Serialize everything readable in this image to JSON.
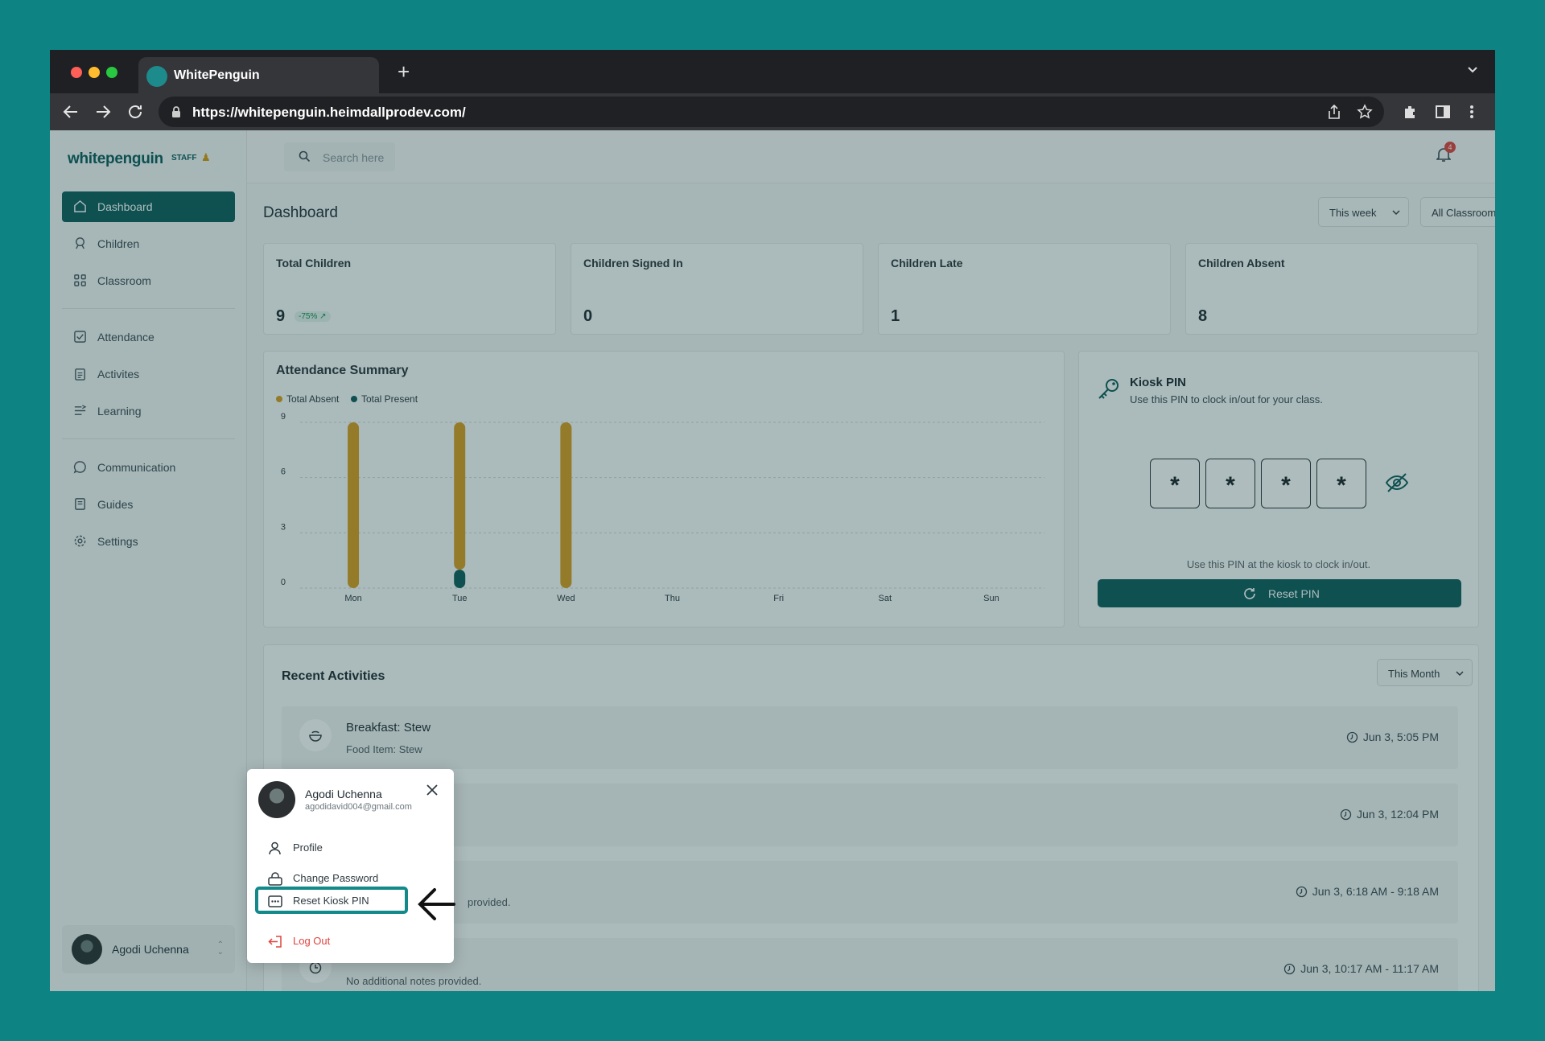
{
  "browser": {
    "tab_title": "WhitePenguin",
    "url": "https://whitepenguin.heimdallprodev.com/"
  },
  "colors": {
    "brand": "#0f5c5b",
    "absent": "#d89d1f",
    "present": "#0f5c5b",
    "highlight": "#138a89",
    "background": "#0d8384"
  },
  "brand": {
    "logo": "whitepenguin",
    "badge": "STAFF"
  },
  "sidebar": {
    "items": [
      {
        "label": "Dashboard",
        "icon": "home-icon"
      },
      {
        "label": "Children",
        "icon": "child-icon"
      },
      {
        "label": "Classroom",
        "icon": "grid-icon"
      },
      {
        "label": "Attendance",
        "icon": "checkbox-icon"
      },
      {
        "label": "Activites",
        "icon": "clipboard-icon"
      },
      {
        "label": "Learning",
        "icon": "learning-icon"
      },
      {
        "label": "Communication",
        "icon": "chat-icon"
      },
      {
        "label": "Guides",
        "icon": "book-icon"
      },
      {
        "label": "Settings",
        "icon": "gear-icon"
      }
    ],
    "user_name": "Agodi Uchenna"
  },
  "topbar": {
    "search_placeholder": "Search here",
    "notification_count": "4"
  },
  "dashboard": {
    "title": "Dashboard",
    "period_filter": "This week",
    "classroom_filter": "All Classrooms",
    "stats": [
      {
        "label": "Total Children",
        "value": "9",
        "change": "-75% ↗"
      },
      {
        "label": "Children Signed In",
        "value": "0"
      },
      {
        "label": "Children Late",
        "value": "1"
      },
      {
        "label": "Children Absent",
        "value": "8"
      }
    ]
  },
  "attendance": {
    "title": "Attendance Summary",
    "legend": [
      "Total Absent",
      "Total Present"
    ]
  },
  "chart_data": {
    "type": "bar",
    "categories": [
      "Mon",
      "Tue",
      "Wed",
      "Thu",
      "Fri",
      "Sat",
      "Sun"
    ],
    "series": [
      {
        "name": "Total Absent",
        "values": [
          9,
          8,
          9,
          0,
          0,
          0,
          0
        ]
      },
      {
        "name": "Total Present",
        "values": [
          0,
          1,
          0,
          0,
          0,
          0,
          0
        ]
      }
    ],
    "yticks": [
      0,
      3,
      6,
      9
    ],
    "ylim": [
      0,
      9
    ],
    "stacked": true,
    "grid": true,
    "legend_position": "top-left"
  },
  "kiosk": {
    "title": "Kiosk PIN",
    "subtitle": "Use this PIN to clock in/out for your class.",
    "pin_digits": [
      "*",
      "*",
      "*",
      "*"
    ],
    "note": "Use this PIN at the kiosk to clock in/out.",
    "reset_label": "Reset PIN"
  },
  "activities": {
    "title": "Recent Activities",
    "filter": "This Month",
    "items": [
      {
        "title": "Breakfast: Stew",
        "desc": "Food Item: Stew",
        "time": "Jun 3, 5:05 PM"
      },
      {
        "title": "",
        "desc": "",
        "time": "Jun 3, 12:04 PM"
      },
      {
        "title": "",
        "desc": "provided.",
        "time": "Jun 3, 6:18 AM - 9:18 AM"
      },
      {
        "title": "",
        "desc": "No additional notes provided.",
        "time": "Jun 3, 10:17 AM - 11:17 AM"
      }
    ]
  },
  "user_menu": {
    "name": "Agodi Uchenna",
    "email": "agodidavid004@gmail.com",
    "items": [
      {
        "label": "Profile",
        "icon": "user-icon"
      },
      {
        "label": "Change Password",
        "icon": "lock-icon"
      },
      {
        "label": "Reset Kiosk PIN",
        "icon": "pin-icon"
      },
      {
        "label": "Log Out",
        "icon": "logout-icon"
      }
    ]
  }
}
